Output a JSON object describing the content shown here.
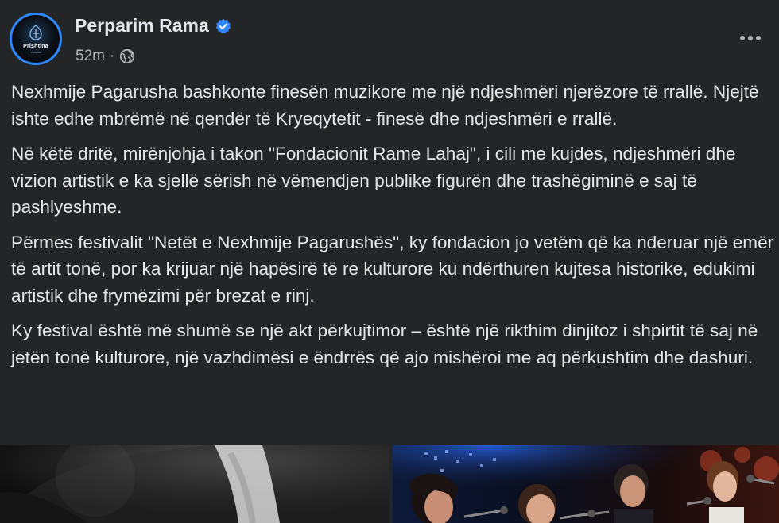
{
  "post": {
    "author": "Perparim Rama",
    "time": "52m",
    "separator": "·",
    "avatar": {
      "logo_text": "Prishtina",
      "logo_subtext": "kryeqyteti"
    },
    "icons": {
      "verified": "verified-badge-icon",
      "audience": "globe-icon",
      "more": "more-options-icon"
    },
    "paragraphs": [
      "Nexhmije Pagarusha bashkonte finesën muzikore me një ndjeshmëri njerëzore të rrallë. Njejtë ishte edhe mbrëmë në qendër të Kryeqytetit - finesë dhe ndjeshmëri e rrallë.",
      "Në këtë dritë, mirënjohja i takon \"Fondacionit Rame Lahaj\", i cili me kujdes, ndjeshmëri dhe vizion artistik e ka sjellë sërish në vëmendjen publike figurën dhe trashëgiminë e saj të pashlyeshme.",
      "Përmes festivalit \"Netët e Nexhmije Pagarushës\", ky fondacion jo vetëm që ka nderuar një emër të artit tonë, por ka krijuar një hapësirë të re kulturore ku ndërthuren kujtesa historike, edukimi artistik dhe frymëzimi për brezat e rinj.",
      "Ky festival është më shumë se një akt përkujtimor – është një rikthim dinjitoz i shpirtit të saj në jetën tonë kulturore, një vazhdimësi e ëndrrës që ajo mishëroi me aq përkushtim dhe dashuri."
    ]
  },
  "colors": {
    "background": "#242526",
    "text_primary": "#e4e6eb",
    "text_secondary": "#b0b3b8",
    "verified_blue": "#2d88ff"
  }
}
